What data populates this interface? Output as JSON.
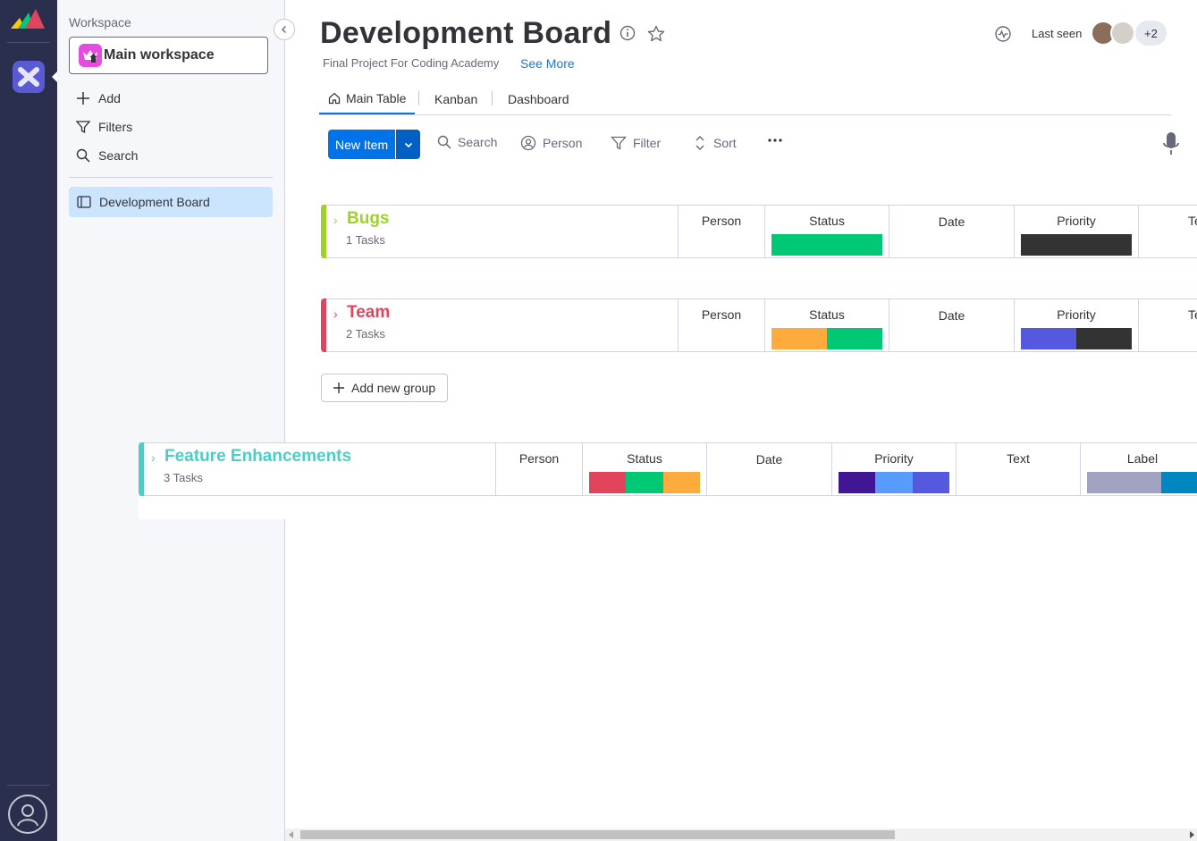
{
  "workspace": {
    "label": "Workspace",
    "name": "Main workspace",
    "menu": [
      {
        "label": "Add",
        "icon": "plus-icon"
      },
      {
        "label": "Filters",
        "icon": "filter-icon"
      },
      {
        "label": "Search",
        "icon": "search-icon"
      }
    ],
    "boards": [
      {
        "label": "Development Board",
        "icon": "board-icon"
      }
    ]
  },
  "board": {
    "title": "Development Board",
    "subtitle": "Final Project For Coding Academy",
    "see_more": "See More",
    "last_seen": "Last seen",
    "more_viewers": "+2"
  },
  "tabs": [
    "Main Table",
    "Kanban",
    "Dashboard"
  ],
  "toolbar": {
    "new_item": "New Item",
    "search": "Search",
    "person": "Person",
    "filter": "Filter",
    "sort": "Sort"
  },
  "colors": {
    "green": "#00c875",
    "dark": "#333333",
    "orange": "#fdab3d",
    "indigo": "#5559df",
    "red": "#e2445c",
    "deep_purple": "#401694",
    "light_blue": "#579bfc",
    "gray_purple": "#a1a1c2",
    "blue": "#0086c0"
  },
  "groups": [
    {
      "name": "Bugs",
      "count": "1 Tasks",
      "color": "#9cd326",
      "columns": {
        "person": "Person",
        "status": "Status",
        "date": "Date",
        "priority": "Priority",
        "text": "Text"
      }
    },
    {
      "name": "Team",
      "count": "2 Tasks",
      "color": "#e2445c",
      "columns": {
        "person": "Person",
        "status": "Status",
        "date": "Date",
        "priority": "Priority",
        "text": "Text"
      }
    },
    {
      "name": "Feature Enhancements",
      "count": "3 Tasks",
      "color": "#4eccc6",
      "columns": {
        "person": "Person",
        "status": "Status",
        "date": "Date",
        "priority": "Priority",
        "text": "Text",
        "label": "Label"
      }
    }
  ],
  "add_group": "Add new group"
}
